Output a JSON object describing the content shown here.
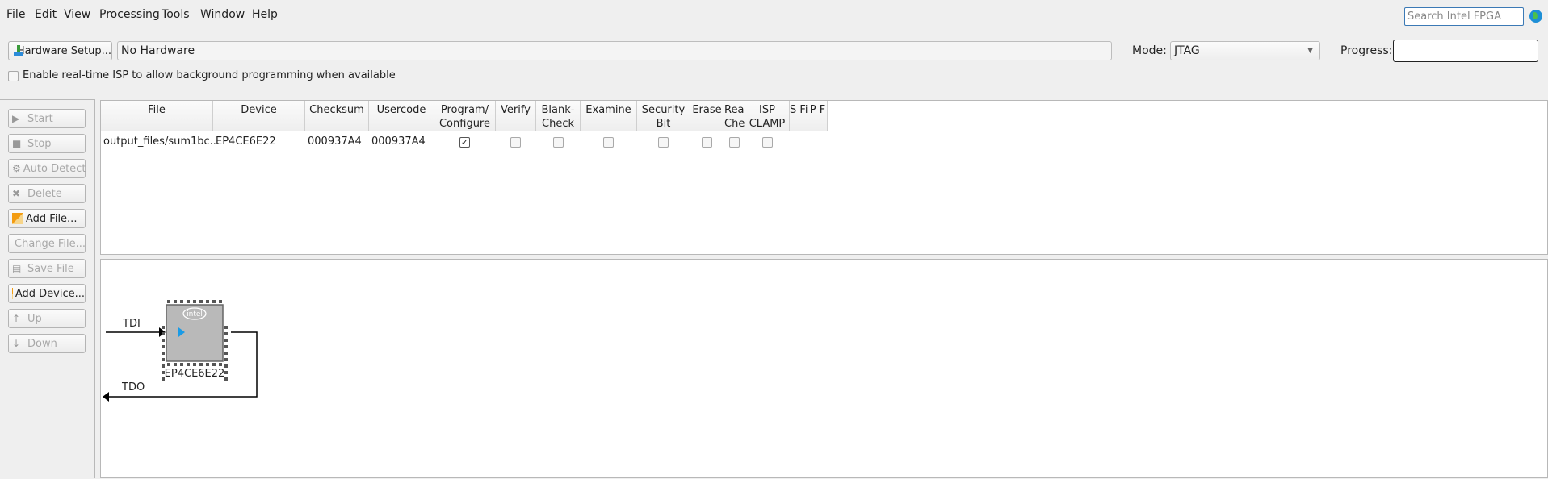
{
  "menu": [
    "File",
    "Edit",
    "View",
    "Processing",
    "Tools",
    "Window",
    "Help"
  ],
  "search": {
    "placeholder": "Search Intel FPGA"
  },
  "hardware": {
    "setup_label": "Hardware Setup...",
    "value": "No Hardware",
    "mode_label": "Mode:",
    "mode_value": "JTAG",
    "progress_label": "Progress:",
    "progress": 0
  },
  "isp_checkbox": {
    "label": "Enable real-time ISP to allow background programming when available",
    "checked": false
  },
  "side_buttons": [
    {
      "label": "Start",
      "enabled": false
    },
    {
      "label": "Stop",
      "enabled": false
    },
    {
      "label": "Auto Detect",
      "enabled": false
    },
    {
      "label": "Delete",
      "enabled": false
    },
    {
      "label": "Add File...",
      "enabled": true
    },
    {
      "label": "Change File...",
      "enabled": false
    },
    {
      "label": "Save File",
      "enabled": false
    },
    {
      "label": "Add Device...",
      "enabled": true
    },
    {
      "label": "Up",
      "enabled": false
    },
    {
      "label": "Down",
      "enabled": false
    }
  ],
  "table": {
    "headers": [
      "File",
      "Device",
      "Checksum",
      "Usercode",
      "Program/\nConfigure",
      "Verify",
      "Blank-\nCheck",
      "Examine",
      "Security\nBit",
      "Erase",
      "Read\nChecks",
      "ISP\nCLAMP",
      "S Fi",
      "P F"
    ],
    "rows": [
      {
        "file": "output_files/sum1bc...",
        "device": "EP4CE6E22",
        "checksum": "000937A4",
        "usercode": "000937A4",
        "program": true,
        "verify": false,
        "blank_check": false,
        "examine": false,
        "security_bit": false,
        "erase": false,
        "read_checks": false,
        "isp_clamp": false
      }
    ]
  },
  "diagram": {
    "tdi": "TDI",
    "tdo": "TDO",
    "device": "EP4CE6E22",
    "logo": "intel"
  }
}
